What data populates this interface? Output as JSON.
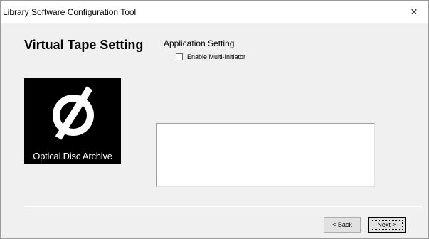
{
  "window": {
    "title": "Library Software Configuration Tool",
    "close_icon": "×"
  },
  "page": {
    "heading": "Virtual Tape Setting",
    "section_label": "Application Setting",
    "checkbox_label": "Enable Multi-Initiator",
    "checkbox_checked": false
  },
  "logo": {
    "caption": "Optical Disc Archive"
  },
  "buttons": {
    "back_prefix": "< ",
    "back_mnemonic": "B",
    "back_rest": "ack",
    "next_mnemonic": "N",
    "next_rest": "ext >"
  },
  "colors": {
    "window_bg": "#f0f0f0",
    "titlebar_bg": "#ffffff",
    "logo_bg": "#000000",
    "logo_fg": "#ffffff"
  }
}
